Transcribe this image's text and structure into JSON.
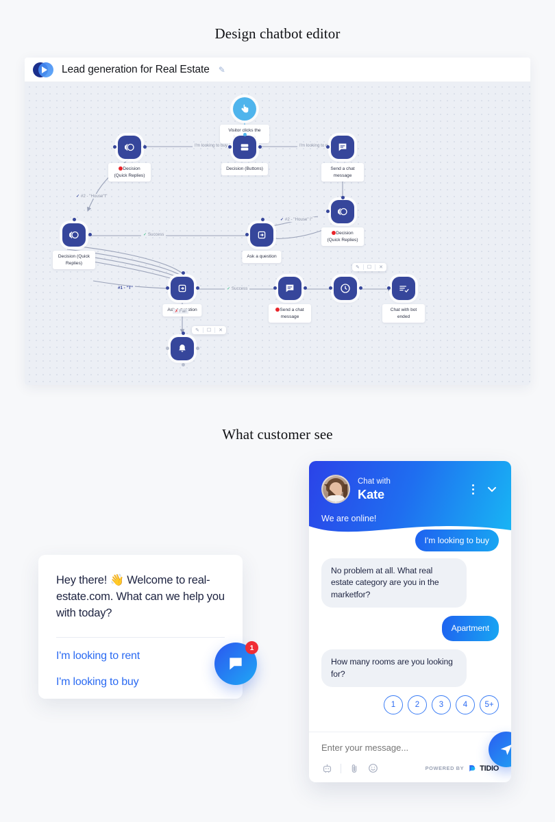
{
  "headings": {
    "editor": "Design chatbot editor",
    "customer": "What customer see"
  },
  "editor": {
    "title": "Lead generation for Real Estate",
    "edit_icon": "pencil-icon",
    "logo_icon": "tidio-play-logo",
    "nodes": [
      {
        "id": "trigger",
        "icon": "hand-click-icon",
        "label": "Visitor clicks the bots button"
      },
      {
        "id": "decision-buttons",
        "icon": "buttons-icon",
        "label": "Decision (Buttons)"
      },
      {
        "id": "decision-qr-1",
        "icon": "quick-replies-icon",
        "label": "Decision (Quick Replies)",
        "dot": "red"
      },
      {
        "id": "send-message-1",
        "icon": "chat-message-icon",
        "label": "Send a chat message"
      },
      {
        "id": "decision-qr-2",
        "icon": "quick-replies-icon",
        "label": "Decision (Quick Replies)",
        "dot": "red"
      },
      {
        "id": "decision-qr-3",
        "icon": "quick-replies-icon",
        "label": "Decision (Quick Replies)"
      },
      {
        "id": "ask-question-1",
        "icon": "ask-question-icon",
        "label": "Ask a question"
      },
      {
        "id": "ask-question-2",
        "icon": "ask-question-icon",
        "label": "Ask a question"
      },
      {
        "id": "send-message-2",
        "icon": "chat-message-icon",
        "label": "Send a chat message",
        "dot": "red"
      },
      {
        "id": "delay",
        "icon": "clock-icon",
        "label": ""
      },
      {
        "id": "chat-ended",
        "icon": "list-check-icon",
        "label": "Chat with bot ended"
      },
      {
        "id": "notify",
        "icon": "bell-icon",
        "label": ""
      }
    ],
    "edge_labels": {
      "buy": "I'm looking to buy",
      "rent": "I'm looking to rent",
      "house2_left": "#2 - \"House\"t\"",
      "house2_right": "#2 - \"House\" l\"",
      "house1": "#1 - \"T\"",
      "success_mid": "Success",
      "success_bottom": "Success",
      "fail": "Fail"
    },
    "mini_toolbar": {
      "edit": "pencil-icon",
      "copy": "copy-icon",
      "close": "close-icon"
    }
  },
  "welcome_card": {
    "message": "Hey there! 👋 Welcome to real-estate.com. What can we help you with today?",
    "options": [
      "I'm looking to rent",
      "I'm looking to buy"
    ],
    "launcher_icon": "chat-bubble-icon",
    "launcher_badge": "1"
  },
  "chat_widget": {
    "header": {
      "chat_with": "Chat with",
      "agent_name": "Kate",
      "status": "We are online!",
      "menu_icon": "kebab-menu-icon",
      "minimize_icon": "chevron-down-icon",
      "avatar_icon": "agent-avatar"
    },
    "messages": [
      {
        "from": "user",
        "text": "I'm looking to buy"
      },
      {
        "from": "bot",
        "text": "No problem at all. What real estate category are you in the marketfor?"
      },
      {
        "from": "user",
        "text": "Apartment"
      },
      {
        "from": "bot",
        "text": "How many rooms are you looking for?"
      }
    ],
    "room_options": [
      "1",
      "2",
      "3",
      "4",
      "5+"
    ],
    "input_placeholder": "Enter your message...",
    "footer_icons": [
      "bot-icon",
      "attachment-icon",
      "emoji-icon"
    ],
    "powered_by": "POWERED BY",
    "brand": "TIDIO",
    "send_icon": "send-icon"
  },
  "colors": {
    "node_blue": "#36469b",
    "trigger_blue": "#4fb4ec",
    "accent_blue": "#2a6af2",
    "success_green": "#22b573",
    "error_red": "#e8242a",
    "page_bg": "#f7f8fa",
    "canvas_bg": "#eceff5"
  }
}
